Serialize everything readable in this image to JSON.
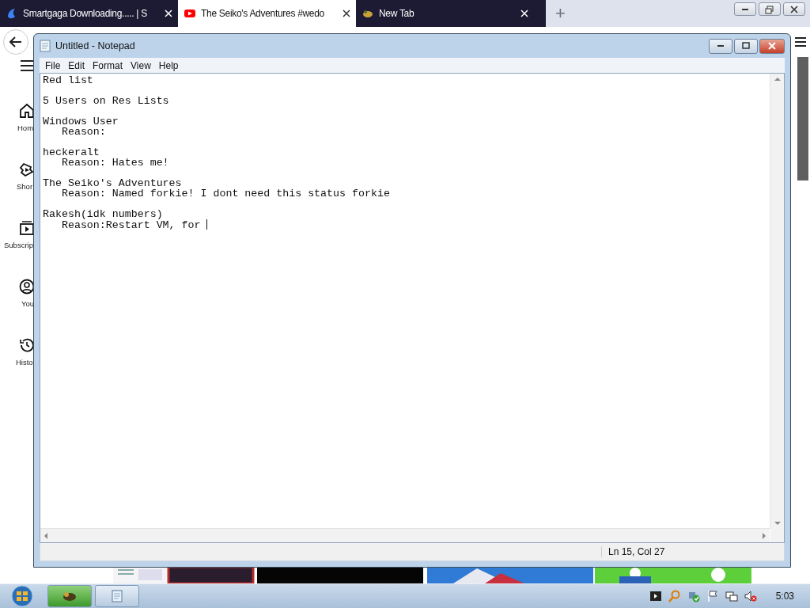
{
  "browser": {
    "tabs": [
      {
        "title": "Smartgaga Downloading..... | S",
        "selected": false
      },
      {
        "title": "The Seiko's Adventures #wedo",
        "selected": true
      },
      {
        "title": "New Tab",
        "selected": false
      }
    ],
    "new_tab_button": "+"
  },
  "sidebar": {
    "items": [
      {
        "label": "Hom"
      },
      {
        "label": "Shor"
      },
      {
        "label": "Subscrip"
      },
      {
        "label": "You"
      },
      {
        "label": "Histo"
      }
    ]
  },
  "notepad": {
    "title": "Untitled - Notepad",
    "menu": [
      "File",
      "Edit",
      "Format",
      "View",
      "Help"
    ],
    "text": "Red list\n\n5 Users on Res Lists\n\nWindows User\n   Reason:\n\nheckeralt\n   Reason: Hates me!\n\nThe Seiko's Adventures\n   Reason: Named forkie! I dont need this status forkie\n\nRakesh(idk numbers)\n   Reason:Restart VM, for ",
    "cursor_visible": true,
    "status": "Ln 15, Col 27"
  },
  "taskbar": {
    "clock": "5:03",
    "volume_muted": true
  }
}
